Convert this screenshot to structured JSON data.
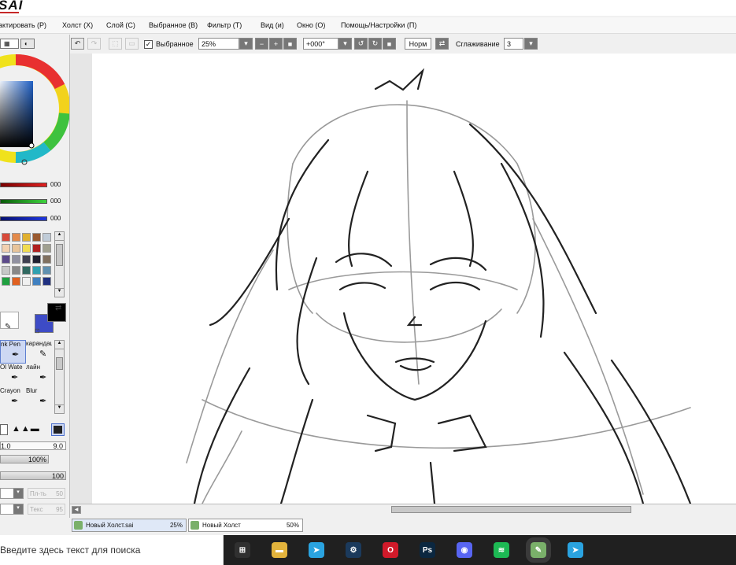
{
  "app": {
    "title": "SAI"
  },
  "menu": {
    "items": [
      "актировать (P)",
      "Холст (X)",
      "Слой (C)",
      "Выбранное (B)",
      "Фильтр (T)",
      "Вид (и)",
      "Окно (O)",
      "Помощь/Настройки (П)"
    ]
  },
  "toolbar": {
    "selection_label": "Выбранное",
    "selection_checked": true,
    "zoom_value": "25%",
    "rotation_value": "+000°",
    "blend_mode": "Норм",
    "smoothing_label": "Сглаживание",
    "smoothing_value": "3"
  },
  "color_sliders": [
    {
      "color": "#c62828",
      "value": "000"
    },
    {
      "color": "#2e9a2e",
      "value": "000"
    },
    {
      "color": "#1e2aa8",
      "value": "000"
    }
  ],
  "palette": {
    "swatches": [
      "#d84a3a",
      "#e38a4a",
      "#e0b030",
      "#9a5a30",
      "#c0ccd8",
      "#f2d0b0",
      "#e8c49a",
      "#f0dc50",
      "#b02020",
      "#a0a090",
      "#5c4a8a",
      "#9090a0",
      "#404050",
      "#202030",
      "#807060",
      "#c8c8c8",
      "#888888",
      "#306860",
      "#30a0b0",
      "#6090b0",
      "#20a040",
      "#e06020",
      "#f0f0f0",
      "#4080c0",
      "#203080"
    ]
  },
  "current_color": {
    "primary": "#000000",
    "secondary": "#3d4bc6"
  },
  "tools": {
    "items": [
      {
        "label": "nk Pen",
        "selected": true
      },
      {
        "label": "карандаш",
        "selected": false
      },
      {
        "label": "Ol Wate",
        "selected": false
      },
      {
        "label": "лайн",
        "selected": false
      },
      {
        "label": "Crayon",
        "selected": false
      },
      {
        "label": "Blur",
        "selected": false
      }
    ]
  },
  "brush": {
    "min_size": "1.0",
    "size": "9.0",
    "min_density": "100%",
    "density": "100",
    "blending_label": "Пл-ть",
    "blending_value": "50",
    "texture_label": "Текс",
    "texture_value": "95"
  },
  "tabs": [
    {
      "name": "Новый Холст.sai",
      "zoom": "25%",
      "active": true
    },
    {
      "name": "Новый Холст",
      "zoom": "50%",
      "active": false
    }
  ],
  "taskbar": {
    "search_placeholder": "Введите здесь текст для поиска",
    "apps": [
      {
        "name": "task-view-icon",
        "color": "#303030",
        "glyph": "⊞"
      },
      {
        "name": "explorer-icon",
        "color": "#e2b33c",
        "glyph": "▬"
      },
      {
        "name": "telegram-icon",
        "color": "#2aa3e0",
        "glyph": "➤"
      },
      {
        "name": "steam-icon",
        "color": "#1b3a5c",
        "glyph": "⚙"
      },
      {
        "name": "opera-icon",
        "color": "#d11a2a",
        "glyph": "O"
      },
      {
        "name": "photoshop-icon",
        "color": "#0b2740",
        "glyph": "Ps"
      },
      {
        "name": "discord-icon",
        "color": "#5865f2",
        "glyph": "◉"
      },
      {
        "name": "spotify-icon",
        "color": "#1db954",
        "glyph": "≋"
      },
      {
        "name": "sai-icon",
        "color": "#7ab06a",
        "glyph": "✎"
      },
      {
        "name": "telegram-desktop-icon",
        "color": "#2aa3e0",
        "glyph": "➤"
      }
    ]
  }
}
